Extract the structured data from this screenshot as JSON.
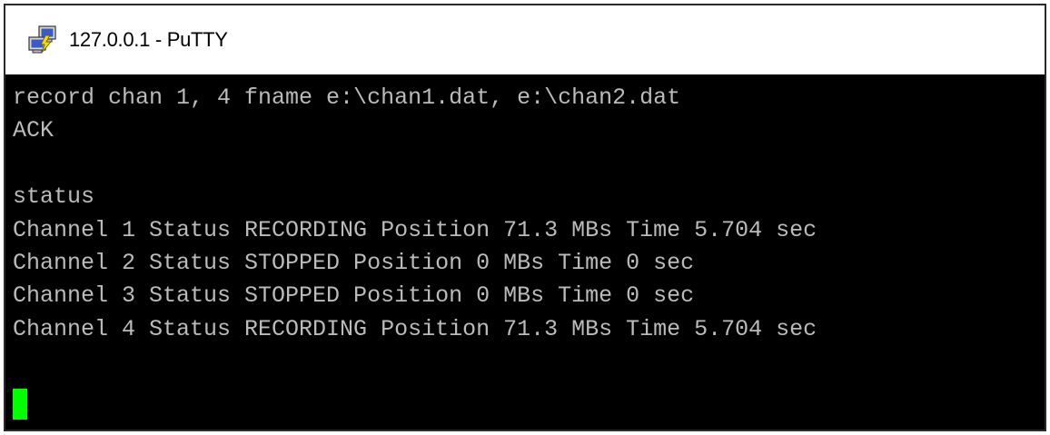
{
  "window": {
    "title": "127.0.0.1 - PuTTY",
    "icon": "putty-icon"
  },
  "terminal": {
    "lines": [
      "record chan 1, 4 fname e:\\chan1.dat, e:\\chan2.dat",
      "ACK",
      "",
      "status",
      "Channel 1 Status RECORDING Position 71.3 MBs Time 5.704 sec",
      "Channel 2 Status STOPPED Position 0 MBs Time 0 sec",
      "Channel 3 Status STOPPED Position 0 MBs Time 0 sec",
      "Channel 4 Status RECORDING Position 71.3 MBs Time 5.704 sec",
      ""
    ],
    "foreground_color": "#bbbbbb",
    "background_color": "#000000",
    "cursor_color": "#00ff00"
  }
}
